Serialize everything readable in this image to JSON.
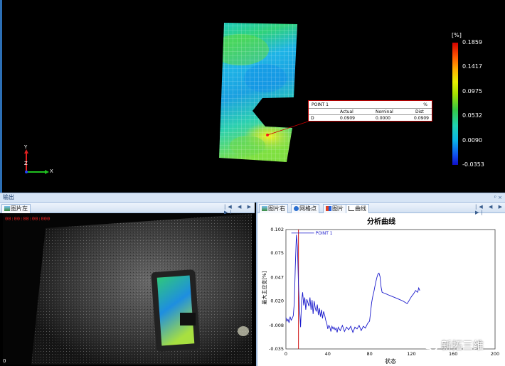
{
  "viewport": {
    "axis_y": "Y",
    "axis_z": "Z",
    "axis_x": "X",
    "colorbar": {
      "unit": "[%]",
      "ticks": [
        "0.1859",
        "0.1417",
        "0.0975",
        "0.0532",
        "0.0090",
        "-0.0353"
      ]
    },
    "callout": {
      "title": "POINT 1",
      "unit": "%",
      "headers": [
        "Actual",
        "Nominal",
        "Dist"
      ],
      "row_label": "D",
      "values": [
        "0.0909",
        "0.0000",
        "0.0909"
      ]
    }
  },
  "output_bar": {
    "title": "输出",
    "pin": "ᵖ ×"
  },
  "left_pane": {
    "tab_label": "图片左",
    "nav": "|◀ ◀ ▶ ▶|",
    "timestamp": "00:00:00:00:000",
    "frame_number": "0"
  },
  "right_pane": {
    "tabs": [
      "图片右",
      "网格点",
      "图片",
      "曲线"
    ],
    "active_tab": "曲线",
    "nav": "|◀ ◀ ▶ ▶|"
  },
  "watermark": "新拓三维",
  "colors": {
    "accent": "#2c6fb5",
    "curve": "#1a1acc",
    "marker": "#d01010"
  },
  "chart_data": {
    "type": "line",
    "title": "分析曲线",
    "xlabel": "状态",
    "ylabel": "最大主应变[%]",
    "xlim": [
      0,
      200
    ],
    "ylim": [
      -0.035,
      0.102
    ],
    "x_ticks": [
      "0",
      "40",
      "80",
      "120",
      "160",
      "200"
    ],
    "y_ticks": [
      "0.102",
      "0.075",
      "0.047",
      "0.020",
      "-0.008",
      "-0.035"
    ],
    "grid": true,
    "marker_line": {
      "x": 12,
      "label": "POINT 1"
    },
    "series": [
      {
        "x": [
          0,
          1,
          2,
          3,
          4,
          5,
          6,
          7,
          8,
          9,
          10,
          11,
          12,
          13,
          14,
          15,
          16,
          17,
          18,
          19,
          20,
          21,
          22,
          23,
          24,
          25,
          26,
          27,
          28,
          29,
          30,
          31,
          32,
          33,
          34,
          35,
          36,
          37,
          38,
          39,
          40,
          41,
          42,
          43,
          44,
          45,
          46,
          47,
          48,
          49,
          50,
          52,
          54,
          56,
          58,
          60,
          62,
          64,
          66,
          68,
          70,
          72,
          74,
          76,
          78,
          80,
          81,
          82,
          83,
          84,
          85,
          86,
          87,
          88,
          89,
          90,
          91,
          92,
          94,
          96,
          98,
          100,
          104,
          108,
          112,
          116,
          118,
          120,
          122,
          124,
          126,
          127,
          128
        ],
        "y": [
          0.001,
          -0.003,
          -0.001,
          -0.005,
          0.002,
          -0.002,
          0.0,
          0.003,
          0.018,
          0.06,
          0.096,
          0.082,
          0.04,
          0.012,
          -0.01,
          0.02,
          0.03,
          0.015,
          0.024,
          0.01,
          0.022,
          0.018,
          0.014,
          0.024,
          0.01,
          0.021,
          0.005,
          0.02,
          0.012,
          0.008,
          0.016,
          0.004,
          0.012,
          0.002,
          0.01,
          0.0,
          0.008,
          0.004,
          -0.002,
          -0.005,
          -0.012,
          -0.008,
          -0.01,
          -0.015,
          -0.009,
          -0.012,
          -0.01,
          -0.013,
          -0.011,
          -0.016,
          -0.01,
          -0.014,
          -0.008,
          -0.015,
          -0.01,
          -0.013,
          -0.009,
          -0.016,
          -0.01,
          -0.012,
          -0.008,
          -0.014,
          -0.009,
          -0.011,
          -0.006,
          -0.003,
          0.008,
          0.018,
          0.025,
          0.03,
          0.036,
          0.042,
          0.047,
          0.051,
          0.052,
          0.048,
          0.036,
          0.03,
          0.029,
          0.028,
          0.027,
          0.026,
          0.024,
          0.022,
          0.02,
          0.017,
          0.021,
          0.025,
          0.028,
          0.032,
          0.03,
          0.035,
          0.032
        ]
      }
    ]
  }
}
